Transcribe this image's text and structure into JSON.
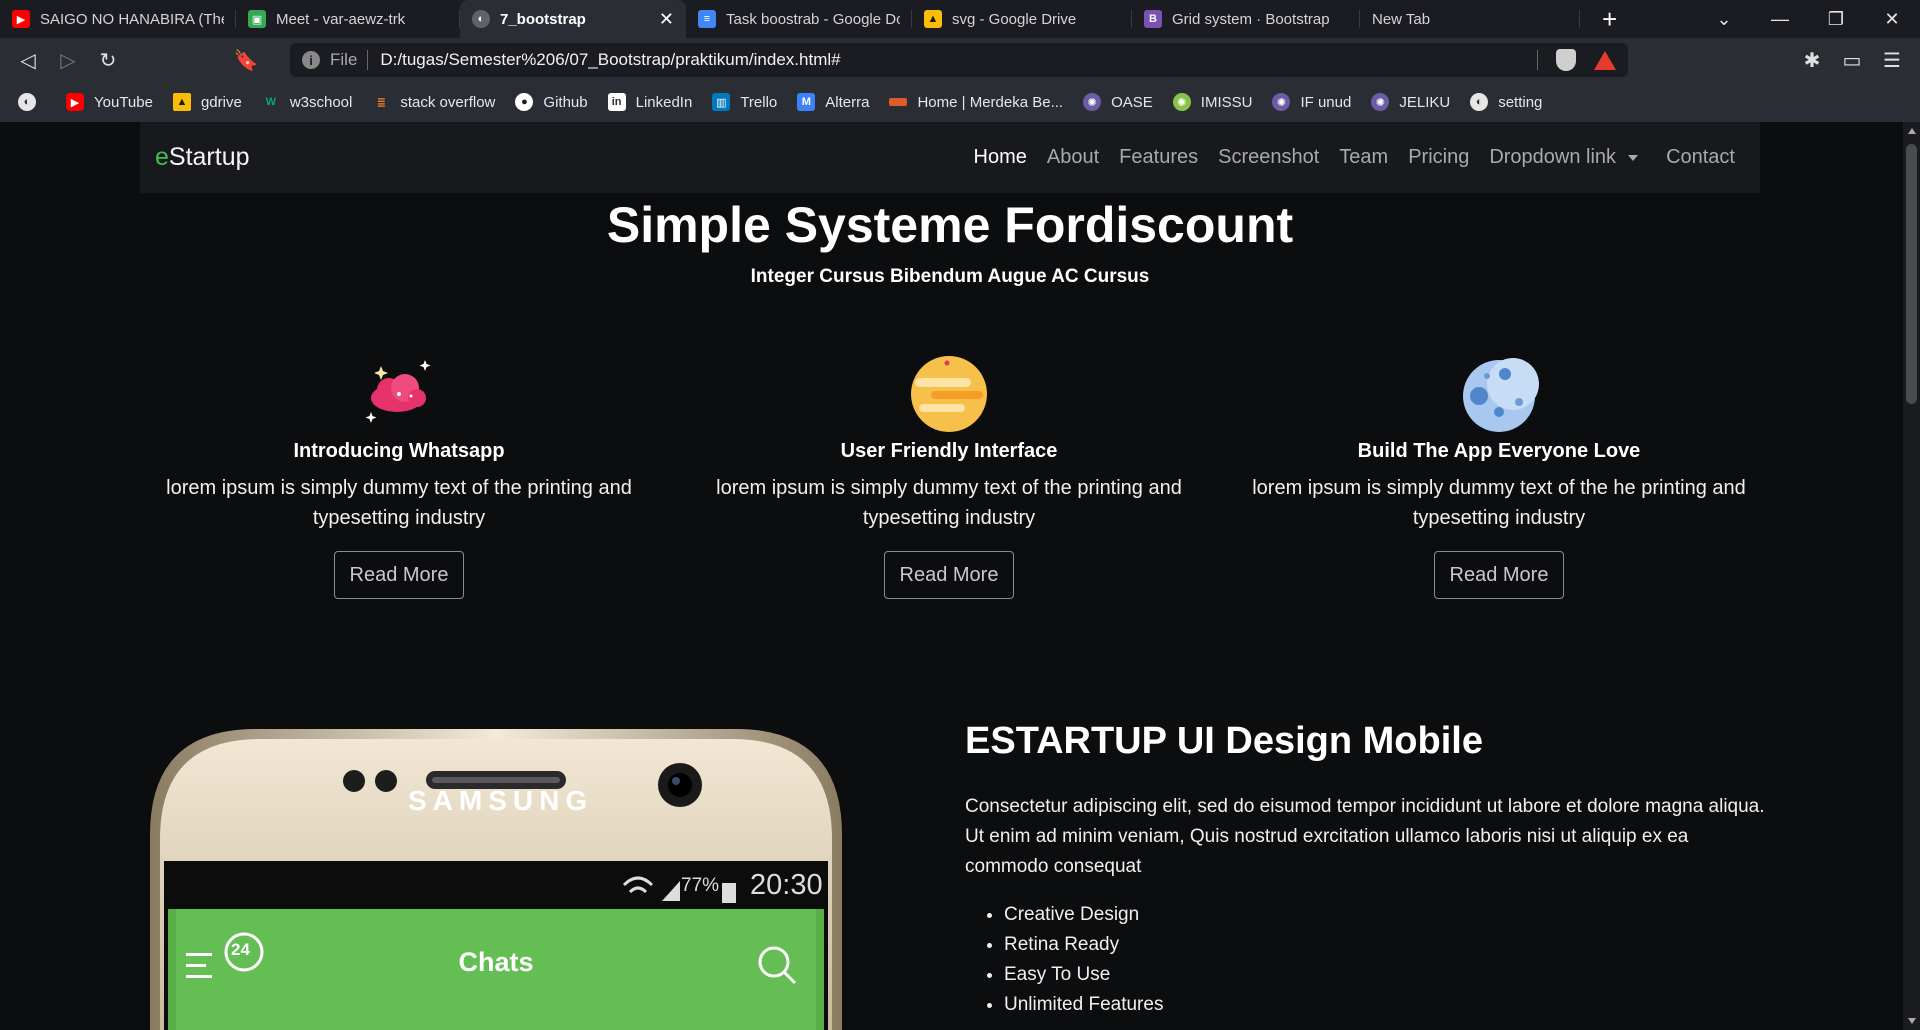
{
  "tabs": [
    {
      "label": "SAIGO NO HANABIRA (The",
      "icon": "youtube-icon",
      "color": "#ff0000",
      "active": false
    },
    {
      "label": "Meet - var-aewz-trk",
      "icon": "meet-icon",
      "color": "#34a853",
      "active": false
    },
    {
      "label": "7_bootstrap",
      "icon": "globe-icon",
      "color": "#9aa0a6",
      "active": true
    },
    {
      "label": "Task boostrab - Google Do",
      "icon": "docs-icon",
      "color": "#4285f4",
      "active": false
    },
    {
      "label": "svg - Google Drive",
      "icon": "drive-icon",
      "color": "#fbbc04",
      "active": false
    },
    {
      "label": "Grid system · Bootstrap",
      "icon": "bootstrap-icon",
      "color": "#7952b3",
      "active": false
    },
    {
      "label": "New Tab",
      "icon": "",
      "color": "",
      "active": false
    }
  ],
  "window_controls": {
    "new_tab": "+",
    "tab_search": "⌄",
    "minimize": "—",
    "restore": "❐",
    "close": "✕"
  },
  "toolbar": {
    "url_scheme": "File",
    "url_path": "D:/tugas/Semester%206/07_Bootstrap/praktikum/index.html#"
  },
  "bookmarks": [
    {
      "label": "",
      "icon": "globe-icon",
      "color": "#e6e6e6"
    },
    {
      "label": "YouTube",
      "icon": "youtube-icon",
      "color": "#ff0000"
    },
    {
      "label": "gdrive",
      "icon": "drive-icon",
      "color": "#fbbc04"
    },
    {
      "label": "w3school",
      "icon": "w3school-icon",
      "color": "#04aa6d"
    },
    {
      "label": "stack overflow",
      "icon": "stackoverflow-icon",
      "color": "#f48024"
    },
    {
      "label": "Github",
      "icon": "github-icon",
      "color": "#ffffff"
    },
    {
      "label": "LinkedIn",
      "icon": "linkedin-icon",
      "color": "#ffffff"
    },
    {
      "label": "Trello",
      "icon": "trello-icon",
      "color": "#0079bf"
    },
    {
      "label": "Alterra",
      "icon": "alterra-icon",
      "color": "#3b82f6"
    },
    {
      "label": "Home | Merdeka Be...",
      "icon": "merdeka-icon",
      "color": "#e05a2b"
    },
    {
      "label": "OASE",
      "icon": "oase-icon",
      "color": "#6b5ca5"
    },
    {
      "label": "IMISSU",
      "icon": "imissu-icon",
      "color": "#8bc34a"
    },
    {
      "label": "IF unud",
      "icon": "ifunud-icon",
      "color": "#6b5ca5"
    },
    {
      "label": "JELIKU",
      "icon": "jeliku-icon",
      "color": "#6b5ca5"
    },
    {
      "label": "setting",
      "icon": "globe-icon",
      "color": "#e6e6e6"
    }
  ],
  "page": {
    "brand_first": "e",
    "brand_rest": "Startup",
    "nav": [
      "Home",
      "About",
      "Features",
      "Screenshot",
      "Team",
      "Pricing",
      "Dropdown link",
      "Contact"
    ],
    "hero_title": "Simple Systeme Fordiscount",
    "hero_subtitle": "Integer Cursus Bibendum Augue AC Cursus",
    "features": [
      {
        "title": "Introducing Whatsapp",
        "text": "lorem ipsum is simply dummy text of the printing and typesetting industry",
        "button": "Read More",
        "icon": "cloud-sparkle-icon"
      },
      {
        "title": "User Friendly Interface",
        "text": "lorem ipsum is simply dummy text of the printing and typesetting industry",
        "button": "Read More",
        "icon": "planet-icon"
      },
      {
        "title": "Build The App Everyone Love",
        "text": "lorem ipsum is simply dummy text of the he printing and typesetting industry",
        "button": "Read More",
        "icon": "moon-icon"
      }
    ],
    "about_title_bold": "ESTARTUP",
    "about_title_rest": " UI Design Mobile",
    "about_text": "Consectetur adipiscing elit, sed do eisumod tempor incididunt ut labore et dolore magna aliqua. Ut enim ad minim veniam, Quis nostrud exrcitation ullamco laboris nisi ut aliquip ex ea commodo consequat",
    "about_list": [
      "Creative Design",
      "Retina Ready",
      "Easy To Use",
      "Unlimited Features"
    ],
    "phone": {
      "brand": "SAMSUNG",
      "battery": "77%",
      "time": "20:30",
      "badge": "24",
      "screen_title": "Chats"
    }
  },
  "colors": {
    "accent_green": "#3fbf52",
    "phone_green": "#64be54",
    "navbar_bg": "#18191c",
    "page_bg": "#0c0d0f"
  }
}
